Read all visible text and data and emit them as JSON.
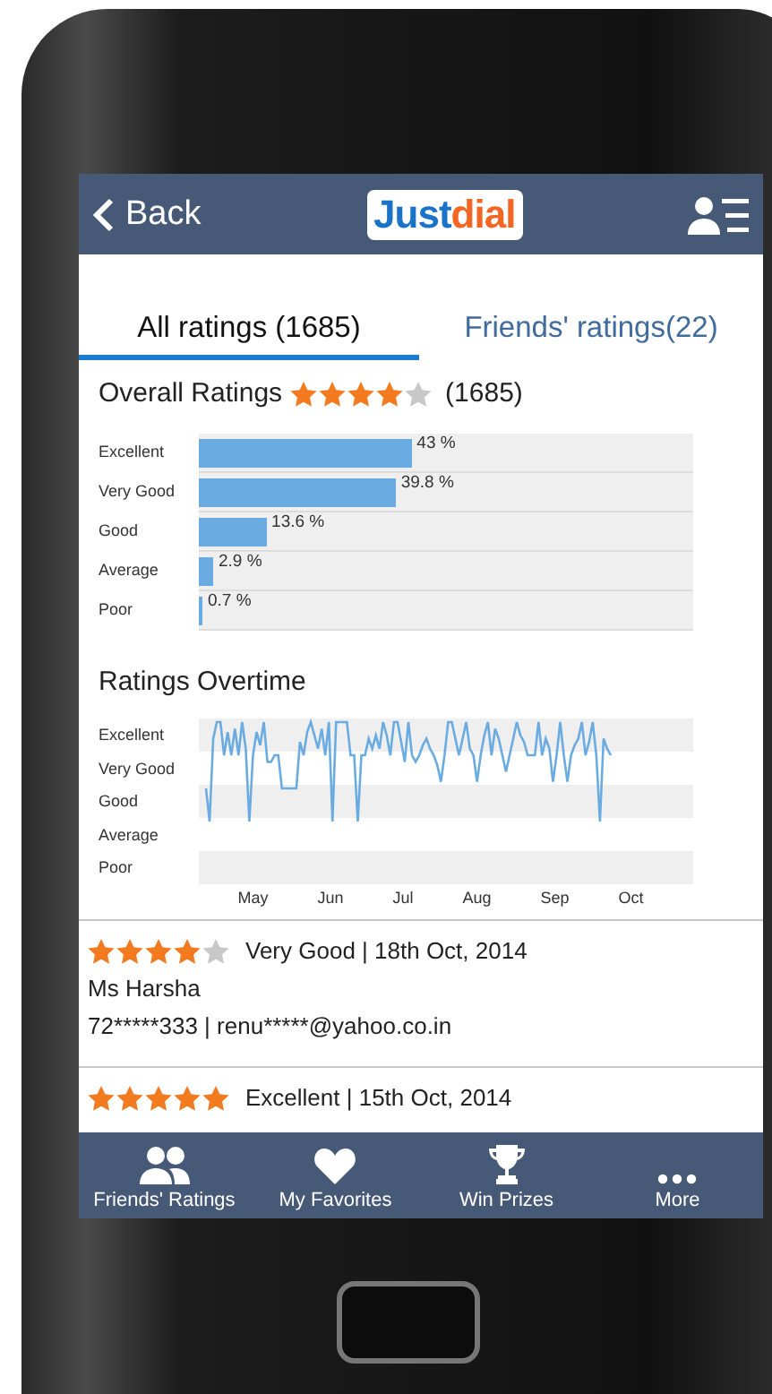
{
  "header": {
    "back": "Back",
    "logo_first": "Just",
    "logo_second": "dial"
  },
  "tabs": [
    {
      "label": "All ratings (1685)",
      "selected": true
    },
    {
      "label": "Friends' ratings(22)",
      "selected": false
    }
  ],
  "overall": {
    "title": "Overall Ratings",
    "stars": 4,
    "count": "(1685)"
  },
  "distribution": {
    "chart_data": {
      "type": "bar",
      "orientation": "horizontal",
      "categories": [
        "Excellent",
        "Very Good",
        "Good",
        "Average",
        "Poor"
      ],
      "values": [
        43,
        39.8,
        13.6,
        2.9,
        0.7
      ],
      "xlim": [
        0,
        100
      ],
      "value_labels": [
        "43 %",
        "39.8 %",
        "13.6 %",
        "2.9 %",
        "0.7 %"
      ]
    }
  },
  "overtime": {
    "title": "Ratings Overtime",
    "y_labels": [
      "Excellent",
      "Very Good",
      "Good",
      "Average",
      "Poor"
    ],
    "x_labels": [
      "May",
      "Jun",
      "Jul",
      "Aug",
      "Sep",
      "Oct"
    ]
  },
  "reviews": [
    {
      "stars": 4,
      "summary": "Very Good | 18th Oct, 2014",
      "name": "Ms Harsha",
      "contact": "72*****333 | renu*****@yahoo.co.in"
    },
    {
      "stars": 5,
      "summary": "Excellent | 15th Oct, 2014"
    }
  ],
  "nav": [
    {
      "kind": "friends",
      "label": "Friends' Ratings"
    },
    {
      "kind": "heart",
      "label": "My Favorites"
    },
    {
      "kind": "trophy",
      "label": "Win Prizes"
    },
    {
      "kind": "more",
      "label": "More"
    }
  ]
}
